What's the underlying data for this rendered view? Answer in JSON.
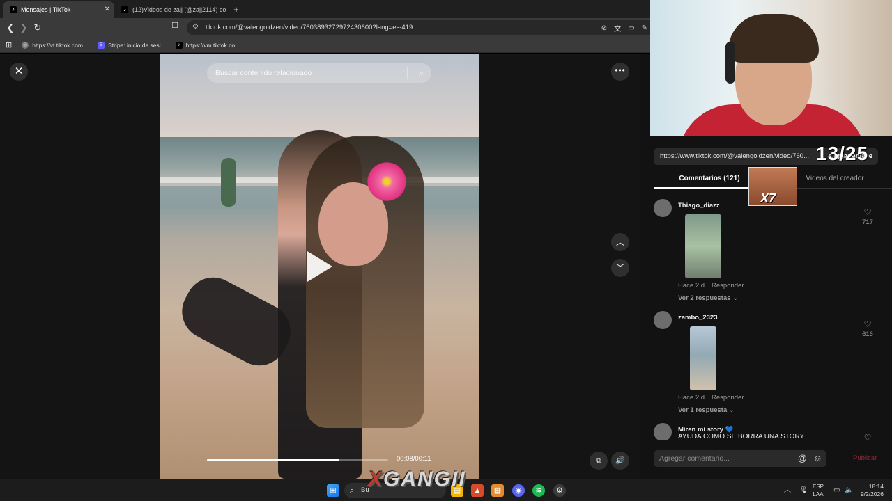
{
  "browser": {
    "tabs": [
      {
        "title": "Mensajes | TikTok",
        "active": true
      },
      {
        "title": "(12)Videos de zajj (@zajj2114) con \"\"",
        "active": false
      }
    ],
    "new_tab": "+",
    "url": "tiktok.com/@valengoldzen/video/7603893272972430600?lang=es-419",
    "bookmarks": [
      {
        "label": "https://vt.tiktok.com...",
        "icon": "globe-icon"
      },
      {
        "label": "Stripe: inicio de sesi...",
        "icon": "stripe-icon"
      },
      {
        "label": "https://vm.tiktok.co...",
        "icon": "tiktok-icon"
      }
    ]
  },
  "player": {
    "search_placeholder": "Buscar contenido relacionado",
    "time": "00:08/00:11",
    "progress": 0.73
  },
  "panel": {
    "share_link": "https://www.tiktok.com/@valengoldzen/video/760...",
    "copy_label": "Copiar enlace",
    "counter_overlay": "13/25",
    "meme_label": "X7",
    "tabs": {
      "comments": "Comentarios (121)",
      "creator_videos": "Videos del creador"
    },
    "comments": [
      {
        "user": "Thiago_diazz",
        "time": "Hace 2 d",
        "reply": "Responder",
        "view_replies": "Ver 2 respuestas",
        "likes": "717"
      },
      {
        "user": "zambo_2323",
        "time": "Hace 2 d",
        "reply": "Responder",
        "view_replies": "Ver 1 respuesta",
        "likes": "616"
      },
      {
        "user": "Miren mi story 💙",
        "text": "AYUDA COMO SE BORRA UNA STORY"
      }
    ],
    "compose_placeholder": "Agregar comentario...",
    "publish": "Publicar"
  },
  "taskbar": {
    "search_label": "Bu",
    "overlay_text": "GANGII",
    "lang_top": "ESP",
    "lang_bottom": "LAA",
    "time": "18:14",
    "date": "9/2/2026"
  },
  "colors": {
    "accent_red": "#fe2c55",
    "panel_bg": "#121212",
    "chrome_bg": "#3a3a3a"
  }
}
